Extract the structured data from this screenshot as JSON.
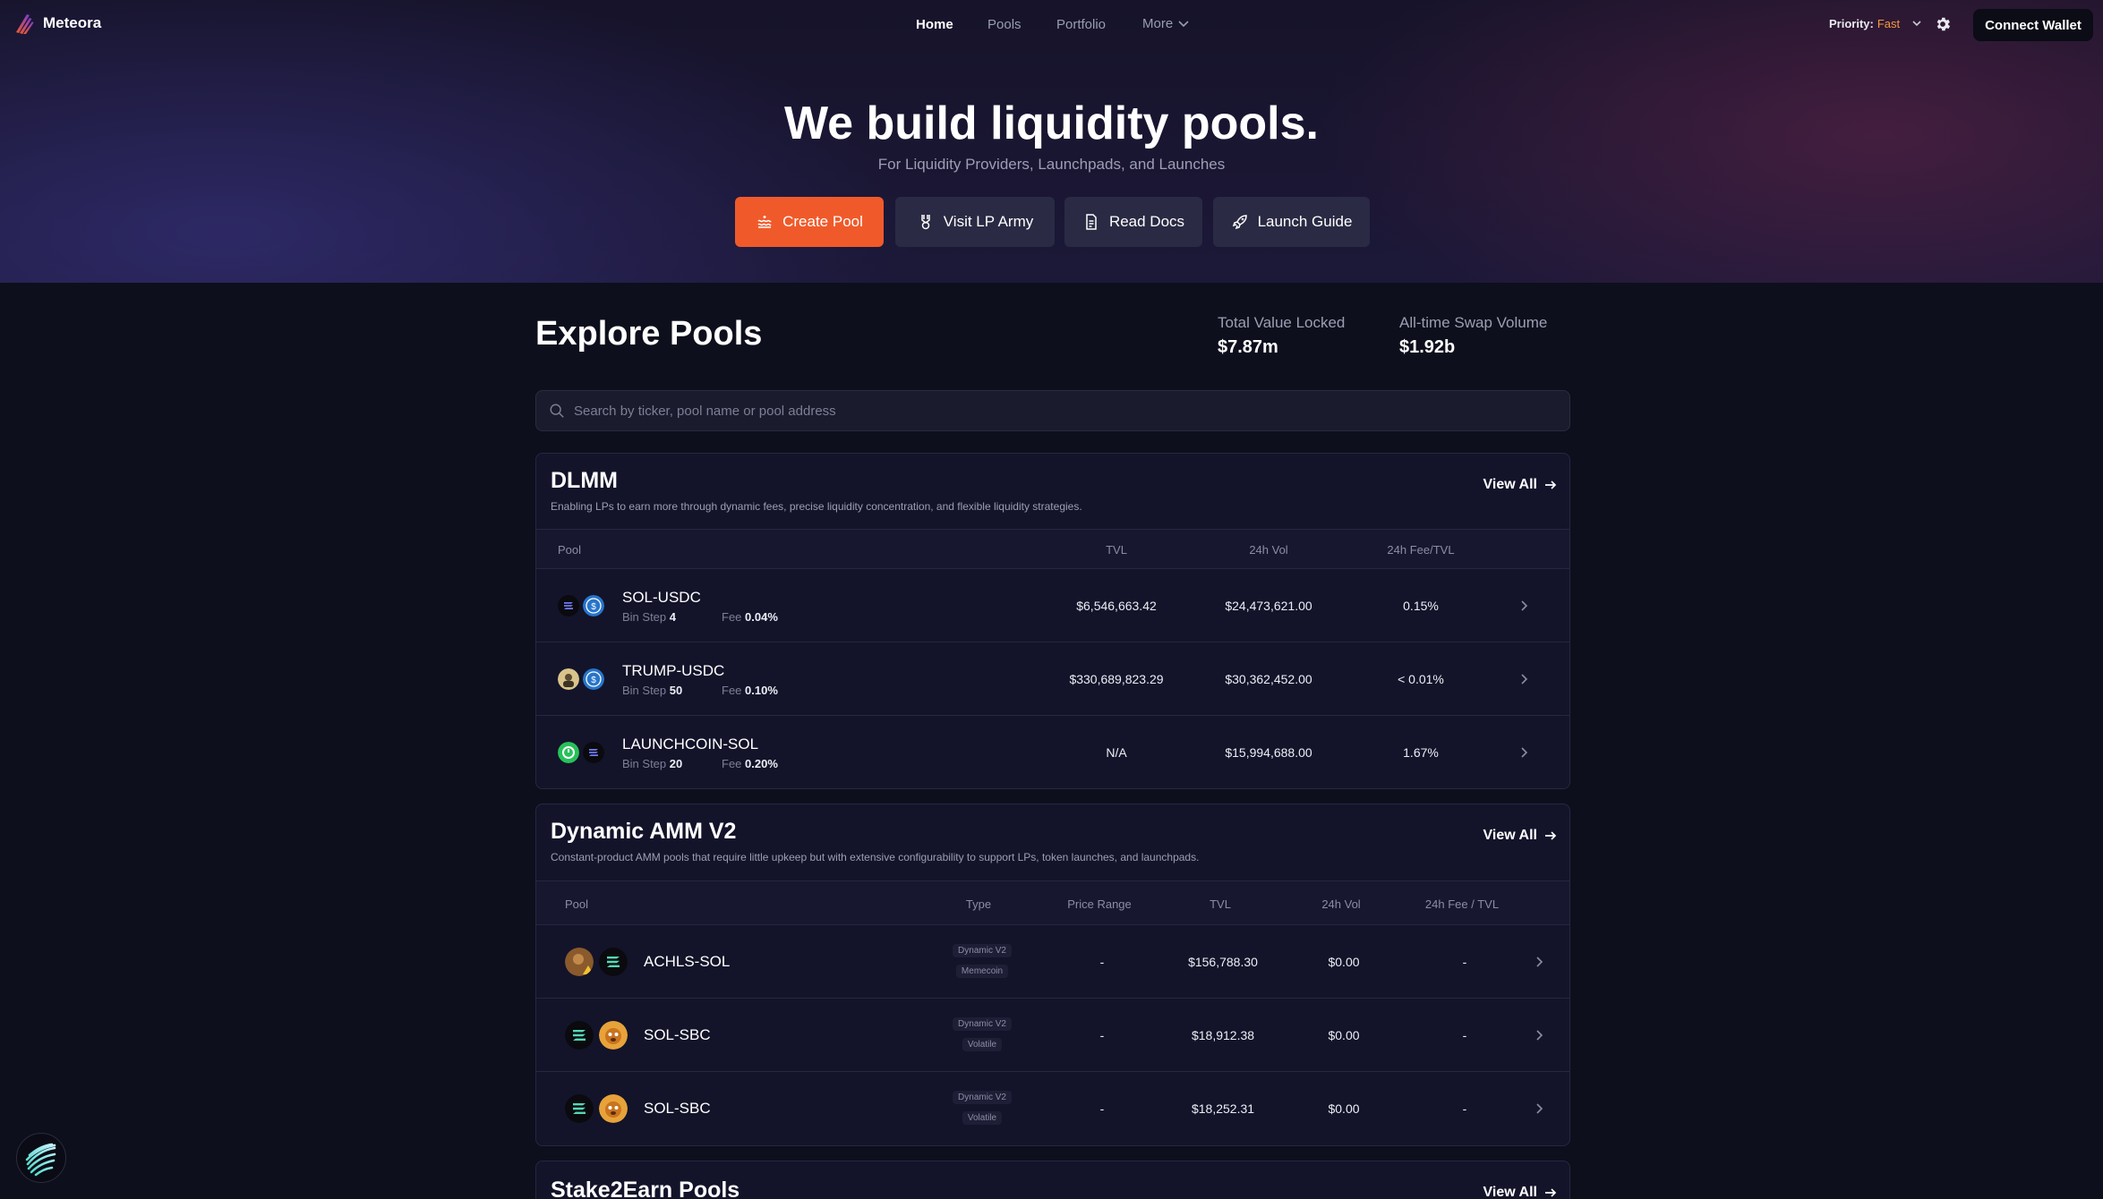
{
  "nav": {
    "brand": "Meteora",
    "links": [
      {
        "label": "Home",
        "active": true
      },
      {
        "label": "Pools",
        "active": false
      },
      {
        "label": "Portfolio",
        "active": false
      },
      {
        "label": "More",
        "active": false
      }
    ],
    "priority_label": "Priority:",
    "priority_value": "Fast",
    "connect_label": "Connect Wallet"
  },
  "hero": {
    "title": "We build liquidity pools.",
    "subtitle": "For Liquidity Providers, Launchpads, and Launches",
    "buttons": [
      "Create Pool",
      "Visit LP Army",
      "Read Docs",
      "Launch Guide"
    ]
  },
  "explore": {
    "title": "Explore Pools",
    "stats": [
      {
        "label": "Total Value Locked",
        "value": "$7.87m"
      },
      {
        "label": "All-time Swap Volume",
        "value": "$1.92b"
      }
    ],
    "search_placeholder": "Search by ticker, pool name or pool address"
  },
  "dlmm": {
    "title": "DLMM",
    "description": "Enabling LPs to earn more through dynamic fees, precise liquidity concentration, and flexible liquidity strategies.",
    "view_all": "View All",
    "headers": [
      "Pool",
      "TVL",
      "24h Vol",
      "24h Fee/TVL"
    ],
    "bin_step_label": "Bin Step",
    "fee_label": "Fee",
    "rows": [
      {
        "name": "SOL-USDC",
        "bin_step": "4",
        "fee": "0.04%",
        "tvl": "$6,546,663.42",
        "vol": "$24,473,621.00",
        "fee_tvl": "0.15%"
      },
      {
        "name": "TRUMP-USDC",
        "bin_step": "50",
        "fee": "0.10%",
        "tvl": "$330,689,823.29",
        "vol": "$30,362,452.00",
        "fee_tvl": "< 0.01%"
      },
      {
        "name": "LAUNCHCOIN-SOL",
        "bin_step": "20",
        "fee": "0.20%",
        "tvl": "N/A",
        "vol": "$15,994,688.00",
        "fee_tvl": "1.67%"
      }
    ]
  },
  "damm": {
    "title": "Dynamic AMM V2",
    "description": "Constant-product AMM pools that require little upkeep but with extensive configurability to support LPs, token launches, and launchpads.",
    "view_all": "View All",
    "headers": [
      "Pool",
      "Type",
      "Price Range",
      "TVL",
      "24h Vol",
      "24h Fee / TVL"
    ],
    "rows": [
      {
        "name": "ACHLS-SOL",
        "type1": "Dynamic V2",
        "type2": "Memecoin",
        "range": "-",
        "tvl": "$156,788.30",
        "vol": "$0.00",
        "fee_tvl": "-"
      },
      {
        "name": "SOL-SBC",
        "type1": "Dynamic V2",
        "type2": "Volatile",
        "range": "-",
        "tvl": "$18,912.38",
        "vol": "$0.00",
        "fee_tvl": "-"
      },
      {
        "name": "SOL-SBC",
        "type1": "Dynamic V2",
        "type2": "Volatile",
        "range": "-",
        "tvl": "$18,252.31",
        "vol": "$0.00",
        "fee_tvl": "-"
      }
    ]
  },
  "stake": {
    "title": "Stake2Earn Pools",
    "view_all": "View All"
  },
  "colors": {
    "accent": "#f05a2a",
    "priority_fast": "#f59a3c",
    "background": "#0d0f1c",
    "card": "#13142a"
  }
}
